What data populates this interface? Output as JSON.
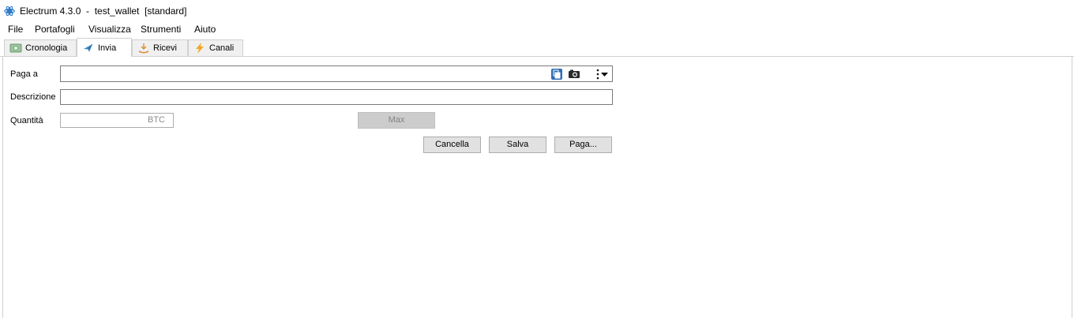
{
  "window": {
    "title": "Electrum 4.3.0  -  test_wallet  [standard]",
    "app_icon": "electrum-logo-icon",
    "accent_color": "#2b78c5"
  },
  "menu": {
    "items": [
      {
        "label": "File"
      },
      {
        "label": "Portafogli"
      },
      {
        "label": "Visualizza"
      },
      {
        "label": "Strumenti"
      },
      {
        "label": "Aiuto"
      }
    ]
  },
  "tabs": [
    {
      "label": "Cronologia",
      "icon": "history-icon",
      "active": false
    },
    {
      "label": "Invia",
      "icon": "send-icon",
      "active": true
    },
    {
      "label": "Ricevi",
      "icon": "receive-icon",
      "active": false
    },
    {
      "label": "Canali",
      "icon": "lightning-icon",
      "active": false
    }
  ],
  "send_form": {
    "pay_to_label": "Paga a",
    "pay_to_value": "",
    "description_label": "Descrizione",
    "description_value": "",
    "amount_label": "Quantità",
    "amount_value": "",
    "amount_unit": "BTC",
    "max_label": "Max",
    "pay_to_icons": [
      "paste-icon",
      "camera-icon",
      "more-menu-icon"
    ]
  },
  "buttons": {
    "cancel_label": "Cancella",
    "save_label": "Salva",
    "pay_label": "Paga..."
  }
}
